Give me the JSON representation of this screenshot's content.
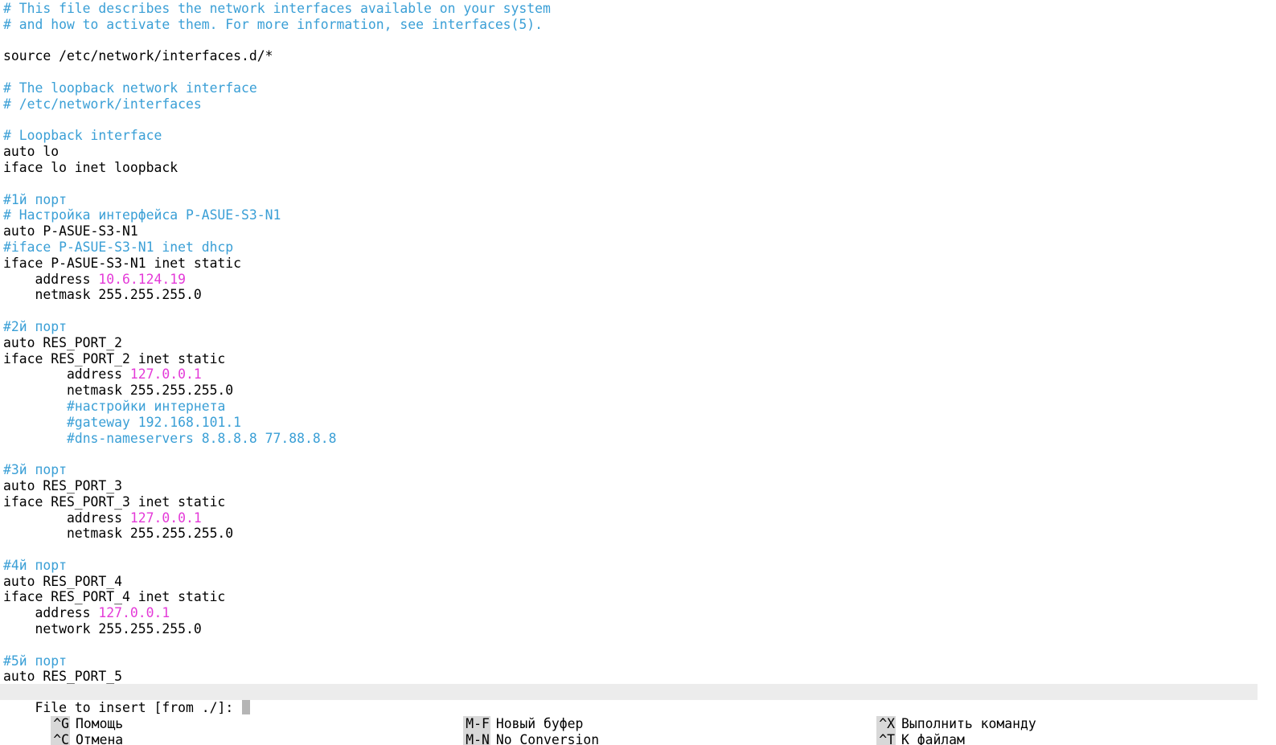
{
  "editor": {
    "lines": [
      [
        {
          "t": "# This file describes the network interfaces available on your system",
          "c": "comment"
        }
      ],
      [
        {
          "t": "# and how to activate them. For more information, see interfaces(5).",
          "c": "comment"
        }
      ],
      [],
      [
        {
          "t": "source /etc/network/interfaces.d/*",
          "c": "plain"
        }
      ],
      [],
      [
        {
          "t": "# The loopback network interface",
          "c": "comment"
        }
      ],
      [
        {
          "t": "# /etc/network/interfaces",
          "c": "comment"
        }
      ],
      [],
      [
        {
          "t": "# Loopback interface",
          "c": "comment"
        }
      ],
      [
        {
          "t": "auto lo",
          "c": "plain"
        }
      ],
      [
        {
          "t": "iface lo inet loopback",
          "c": "plain"
        }
      ],
      [],
      [
        {
          "t": "#1й порт",
          "c": "comment"
        }
      ],
      [
        {
          "t": "# Настройка интерфейса P-ASUE-S3-N1",
          "c": "comment"
        }
      ],
      [
        {
          "t": "auto P-ASUE-S3-N1",
          "c": "plain"
        }
      ],
      [
        {
          "t": "#iface P-ASUE-S3-N1 inet dhcp",
          "c": "comment"
        }
      ],
      [
        {
          "t": "iface P-ASUE-S3-N1 inet static",
          "c": "plain"
        }
      ],
      [
        {
          "t": "    address ",
          "c": "plain"
        },
        {
          "t": "10.6.124.19",
          "c": "num"
        }
      ],
      [
        {
          "t": "    netmask 255.255.255.0",
          "c": "plain"
        }
      ],
      [],
      [
        {
          "t": "#2й порт",
          "c": "comment"
        }
      ],
      [
        {
          "t": "auto RES_PORT_2",
          "c": "plain"
        }
      ],
      [
        {
          "t": "iface RES_PORT_2 inet static",
          "c": "plain"
        }
      ],
      [
        {
          "t": "        address ",
          "c": "plain"
        },
        {
          "t": "127.0.0.1",
          "c": "num"
        }
      ],
      [
        {
          "t": "        netmask 255.255.255.0",
          "c": "plain"
        }
      ],
      [
        {
          "t": "        ",
          "c": "plain"
        },
        {
          "t": "#настройки интернета",
          "c": "comment"
        }
      ],
      [
        {
          "t": "        ",
          "c": "plain"
        },
        {
          "t": "#gateway 192.168.101.1",
          "c": "comment"
        }
      ],
      [
        {
          "t": "        ",
          "c": "plain"
        },
        {
          "t": "#dns-nameservers 8.8.8.8 77.88.8.8",
          "c": "comment"
        }
      ],
      [],
      [
        {
          "t": "#3й порт",
          "c": "comment"
        }
      ],
      [
        {
          "t": "auto RES_PORT_3",
          "c": "plain"
        }
      ],
      [
        {
          "t": "iface RES_PORT_3 inet static",
          "c": "plain"
        }
      ],
      [
        {
          "t": "        address ",
          "c": "plain"
        },
        {
          "t": "127.0.0.1",
          "c": "num"
        }
      ],
      [
        {
          "t": "        netmask 255.255.255.0",
          "c": "plain"
        }
      ],
      [],
      [
        {
          "t": "#4й порт",
          "c": "comment"
        }
      ],
      [
        {
          "t": "auto RES_PORT_4",
          "c": "plain"
        }
      ],
      [
        {
          "t": "iface RES_PORT_4 inet static",
          "c": "plain"
        }
      ],
      [
        {
          "t": "    address ",
          "c": "plain"
        },
        {
          "t": "127.0.0.1",
          "c": "num"
        }
      ],
      [
        {
          "t": "    network 255.255.255.0",
          "c": "plain"
        }
      ],
      [],
      [
        {
          "t": "#5й порт",
          "c": "comment"
        }
      ],
      [
        {
          "t": "auto RES_PORT_5",
          "c": "plain"
        }
      ]
    ]
  },
  "prompt": {
    "text": "File to insert [from ./]: "
  },
  "shortcuts": [
    {
      "key": "^G",
      "label": "Помощь"
    },
    {
      "key": "^C",
      "label": "Отмена"
    },
    {
      "key": "M-F",
      "label": "Новый буфер"
    },
    {
      "key": "M-N",
      "label": "No Conversion"
    },
    {
      "key": "^X",
      "label": "Выполнить команду"
    },
    {
      "key": "^T",
      "label": "К файлам"
    }
  ],
  "colors": {
    "background": "#ffffff",
    "comment": "#3a9fd6",
    "number": "#e43ad8",
    "prompt_bar": "#ececec",
    "key_background": "#d8d8d8"
  }
}
